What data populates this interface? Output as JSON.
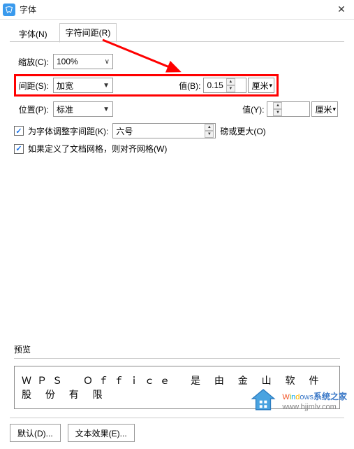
{
  "titlebar": {
    "title": "字体"
  },
  "tabs": {
    "font": "字体(N)",
    "spacing": "字符间距(R)"
  },
  "rows": {
    "scale": {
      "label": "缩放(C):",
      "value": "100%"
    },
    "spacing": {
      "label": "间距(S):",
      "value": "加宽",
      "val_label": "值(B):",
      "val": "0.15",
      "unit": "厘米"
    },
    "position": {
      "label": "位置(P):",
      "value": "标准",
      "val_label": "值(Y):",
      "val": "",
      "unit": "厘米"
    }
  },
  "checks": {
    "kerning": {
      "label": "为字体调整字间距(K):",
      "size": "六号",
      "suffix": "磅或更大(O)"
    },
    "grid": {
      "label": "如果定义了文档网格，则对齐网格(W)"
    }
  },
  "preview": {
    "label": "预览",
    "text": "ＷＰＳ　Ｏｆｆｉｃｅ　是 由 金 山 软 件 股 份 有 限"
  },
  "buttons": {
    "default": "默认(D)...",
    "text_effects": "文本效果(E)..."
  },
  "watermark": {
    "brand": "Windows",
    "cn": "系统之家",
    "url": "www.bjjmlv.com"
  }
}
